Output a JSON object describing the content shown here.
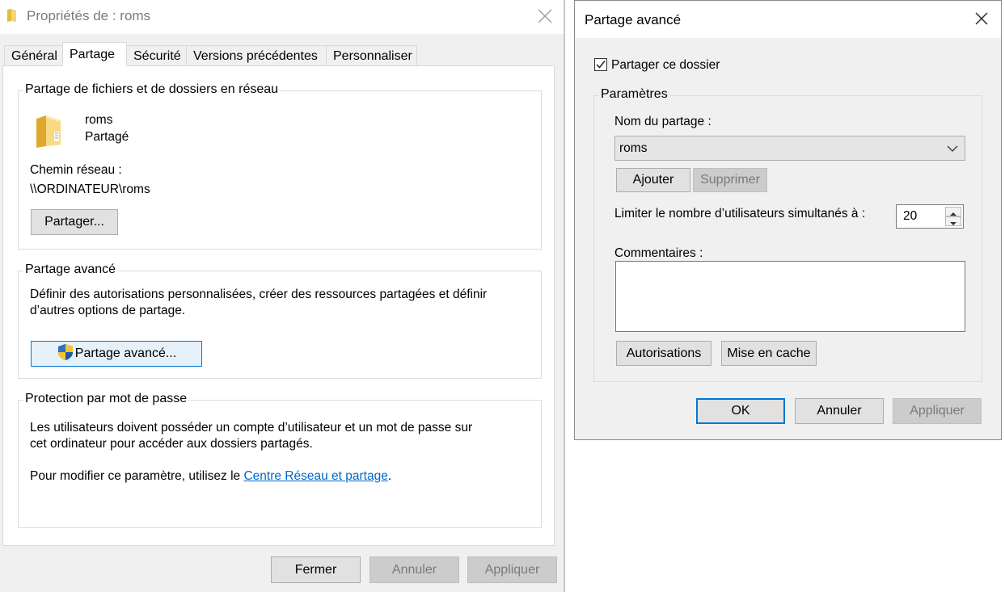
{
  "props_window": {
    "title": "Propriétés de : roms",
    "tabs": [
      {
        "label": "Général"
      },
      {
        "label": "Partage"
      },
      {
        "label": "Sécurité"
      },
      {
        "label": "Versions précédentes"
      },
      {
        "label": "Personnaliser"
      }
    ],
    "active_tab": "Partage",
    "network_sharing": {
      "legend": "Partage de fichiers et de dossiers en réseau",
      "folder_name": "roms",
      "folder_status": "Partagé",
      "network_path_label": "Chemin réseau :",
      "network_path": "\\\\ORDINATEUR\\roms",
      "share_button": "Partager..."
    },
    "advanced_sharing": {
      "legend": "Partage avancé",
      "description_line1": "Définir des autorisations personnalisées, créer des ressources partagées et définir",
      "description_line2": "d’autres options de partage.",
      "button": "Partage avancé..."
    },
    "password_protection": {
      "legend": "Protection par mot de passe",
      "line1": "Les utilisateurs doivent posséder un compte d’utilisateur et un mot de passe sur",
      "line2": "cet ordinateur pour accéder aux dossiers partagés.",
      "change_prefix": "Pour modifier ce paramètre, utilisez le ",
      "link": "Centre Réseau et partage",
      "change_suffix": "."
    },
    "footer": {
      "close": "Fermer",
      "cancel": "Annuler",
      "apply": "Appliquer"
    }
  },
  "advanced_dialog": {
    "title": "Partage avancé",
    "share_checkbox_label": "Partager ce dossier",
    "share_checked": true,
    "settings_legend": "Paramètres",
    "share_name_label": "Nom du partage :",
    "share_name_value": "roms",
    "add_button": "Ajouter",
    "remove_button": "Supprimer",
    "limit_label": "Limiter le nombre d’utilisateurs simultanés à :",
    "limit_value": "20",
    "comments_label": "Commentaires :",
    "comments_value": "",
    "permissions_button": "Autorisations",
    "cache_button": "Mise en cache",
    "ok": "OK",
    "cancel": "Annuler",
    "apply": "Appliquer"
  },
  "icons": {
    "title_folder": "folder-icon",
    "folder": "shared-folder-icon",
    "shield": "uac-shield-icon",
    "close": "close-icon",
    "dropdown": "chevron-down-icon",
    "spin_up": "spin-up-arrow-icon",
    "spin_down": "spin-down-arrow-icon",
    "check": "checkmark-icon"
  },
  "colors": {
    "accent": "#0078d7",
    "link": "#0066cc",
    "window_bg": "#f0f0f0"
  }
}
